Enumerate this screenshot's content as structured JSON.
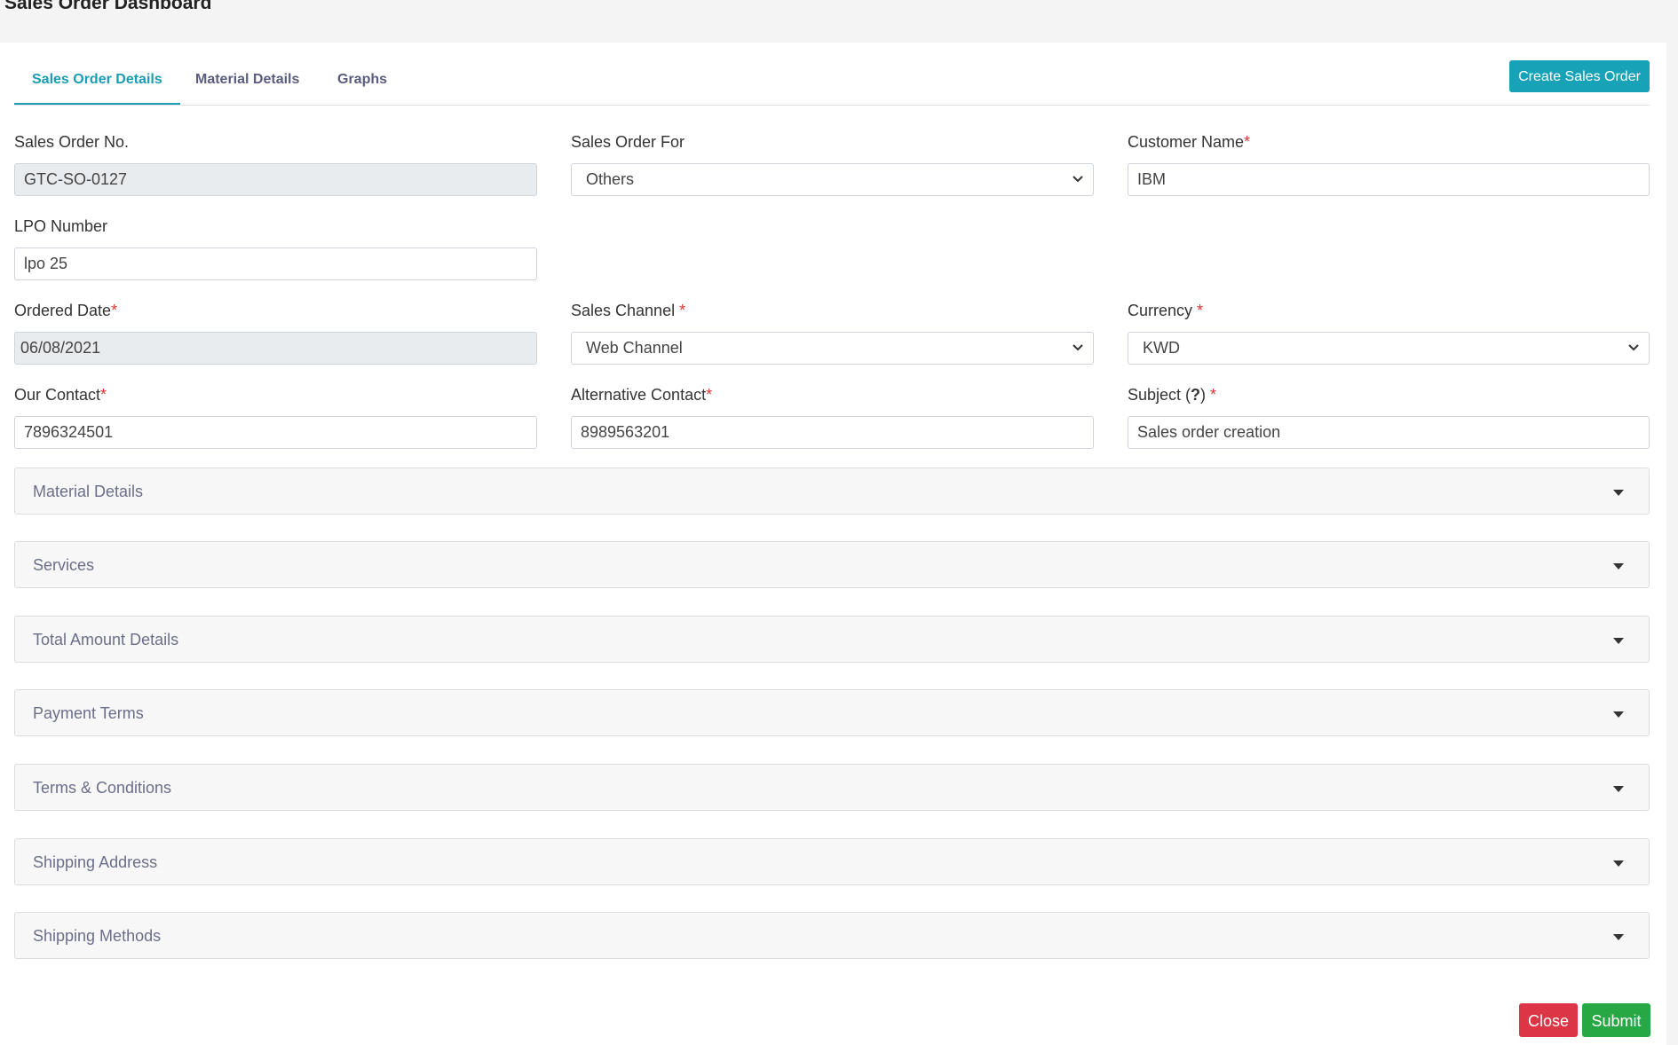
{
  "page": {
    "title": "Sales Order Dashboard"
  },
  "tabs": [
    {
      "label": "Sales Order Details",
      "active": true
    },
    {
      "label": "Material Details",
      "active": false
    },
    {
      "label": "Graphs",
      "active": false
    }
  ],
  "actions": {
    "create_label": "Create Sales Order"
  },
  "form": {
    "sales_order_no": {
      "label": "Sales Order No.",
      "value": "GTC-SO-0127"
    },
    "sales_order_for": {
      "label": "Sales Order For",
      "value": "Others"
    },
    "customer_name": {
      "label": "Customer Name",
      "value": "IBM"
    },
    "lpo_number": {
      "label": "LPO Number",
      "value": "lpo 25"
    },
    "ordered_date": {
      "label": "Ordered Date",
      "value": "06/08/2021"
    },
    "sales_channel": {
      "label": "Sales Channel ",
      "value": "Web Channel"
    },
    "currency": {
      "label": "Currency ",
      "value": "KWD"
    },
    "our_contact": {
      "label": "Our Contact",
      "value": "7896324501"
    },
    "alternative_contact": {
      "label": "Alternative Contact",
      "value": "8989563201"
    },
    "subject": {
      "label_prefix": "Subject (",
      "help": "?",
      "label_suffix": ") ",
      "value": "Sales order creation"
    },
    "required_mark": "*"
  },
  "sections": [
    "Material Details",
    "Services",
    "Total Amount Details",
    "Payment Terms",
    "Terms & Conditions",
    "Shipping Address",
    "Shipping Methods"
  ],
  "footer": {
    "close_label": "Close",
    "submit_label": "Submit"
  },
  "colors": {
    "accent": "#17a2b8",
    "required": "#e3342f",
    "close": "#dc3545",
    "submit": "#28a745"
  }
}
